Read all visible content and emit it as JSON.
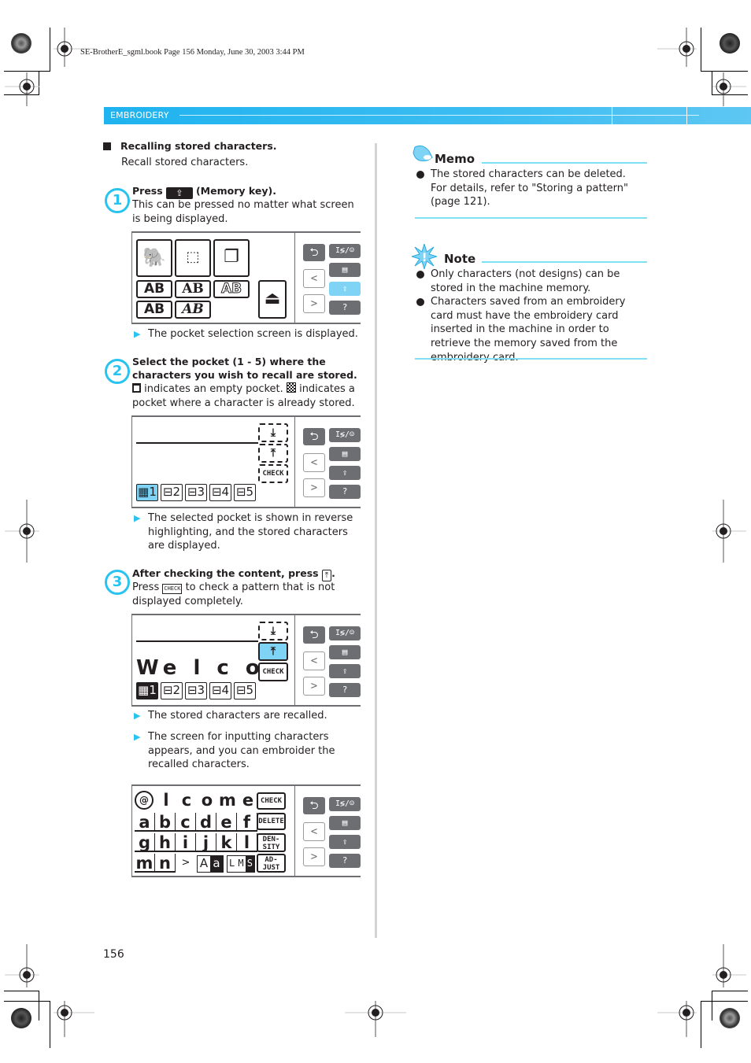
{
  "book_header": "SE-BrotherE_sgml.book  Page 156  Monday, June 30, 2003  3:44 PM",
  "section_band": {
    "label": "EMBROIDERY",
    "color": "#1fb3ef"
  },
  "section": {
    "title": "Recalling stored characters.",
    "intro": "Recall stored characters."
  },
  "steps": [
    {
      "number": "1",
      "heading_pre": "Press",
      "heading_key": "memory-key-icon",
      "heading_post": "(Memory key).",
      "body": "This can be pressed no matter what screen is being displayed.",
      "results": [
        "The pocket selection screen is displayed."
      ]
    },
    {
      "number": "2",
      "heading": "Select the pocket (1 - 5) where the characters you wish to recall are stored.",
      "body_pre": "indicates an empty pocket.",
      "body_post": "indicates a pocket where a character is already stored.",
      "results": [
        "The selected pocket is shown in reverse highlighting, and the stored characters are displayed."
      ]
    },
    {
      "number": "3",
      "heading_pre": "After checking the content, press",
      "heading_post": ".",
      "body_pre": "Press",
      "body_key": "CHECK",
      "body_post": "to check a pattern that is not displayed completely.",
      "results": [
        "The stored characters are recalled.",
        "The screen for inputting characters appears, and you can embroider the recalled characters."
      ]
    }
  ],
  "lcd": {
    "side_buttons": {
      "back": "⮌",
      "prev": "<",
      "next": ">",
      "mode": "I≶/☺",
      "page": "▤",
      "memory": "⇪",
      "help": "?"
    },
    "screen1": {
      "font_tiles": [
        "AB",
        "AB",
        "AB",
        "AB",
        "AB"
      ]
    },
    "screen2": {
      "check_label": "CHECK",
      "pockets": [
        "1",
        "2",
        "3",
        "4",
        "5"
      ],
      "selected_pocket": "1"
    },
    "screen3": {
      "check_label": "CHECK",
      "preview_text": "We l c om",
      "pockets": [
        "1",
        "2",
        "3",
        "4",
        "5"
      ],
      "selected_pocket": "1"
    },
    "screen4": {
      "row1": [
        "l",
        "c",
        "o",
        "m",
        "e"
      ],
      "row2": [
        "a",
        "b",
        "c",
        "d",
        "e",
        "f"
      ],
      "row3": [
        "g",
        "h",
        "i",
        "j",
        "k",
        "l"
      ],
      "row4": [
        "m",
        "n",
        ">"
      ],
      "case_toggle": [
        "A",
        "a"
      ],
      "size_toggle": [
        "L",
        "M",
        "S"
      ],
      "functions": [
        "CHECK",
        "DELETE",
        "DEN-\nSITY",
        "AD-\nJUST"
      ]
    }
  },
  "memo": {
    "title": "Memo",
    "items": [
      "The stored characters can be deleted. For details, refer to \"Storing a pattern\" (page 121)."
    ]
  },
  "note": {
    "title": "Note",
    "items": [
      "Only characters (not designs) can be stored in the machine memory.",
      "Characters saved from an embroidery card must have the embroidery card inserted in the machine in order to retrieve the memory saved from the embroidery card."
    ]
  },
  "page_number": "156",
  "colors": {
    "accent": "#29c3ef",
    "highlight": "#7fd4f5",
    "rule": "#7fe0f3",
    "dark_button": "#6d6e71"
  }
}
